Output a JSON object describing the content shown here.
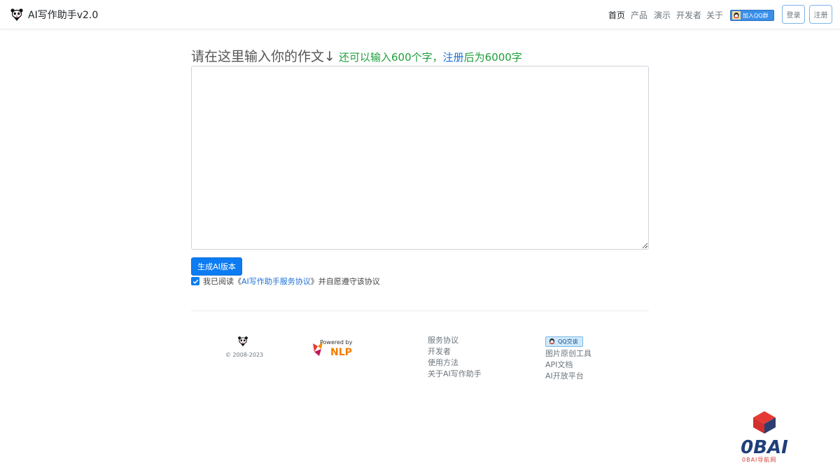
{
  "navbar": {
    "brand": "AI写作助手v2.0",
    "links": [
      "首页",
      "产品",
      "演示",
      "开发者",
      "关于"
    ],
    "active": "首页",
    "qq_group": "加入QQ群",
    "login": "登录",
    "register": "注册"
  },
  "main": {
    "heading": "请在这里输入你的作文↓",
    "hint_prefix": "还可以输入600个字，",
    "hint_register": "注册",
    "hint_suffix": "后为6000字",
    "editor_value": "",
    "generate_button": "生成AI版本",
    "agree_checked": true,
    "agree_prefix": "我已阅读《",
    "agree_link": "AI写作助手服务协议",
    "agree_suffix": "》并自愿遵守该协议"
  },
  "footer": {
    "copyright": "© 2008-2023",
    "powered_by": "Powered by",
    "powered_brand": "NLP",
    "links_col1": [
      "服务协议",
      "开发者",
      "使用方法",
      "关于AI写作助手"
    ],
    "qq_talk": "QQ交谈",
    "links_col2": [
      "图片原创工具",
      "API文档",
      "AI开放平台"
    ]
  },
  "watermark": {
    "logo_text": "0BAI",
    "sub_text": "0BAI导航网"
  },
  "colors": {
    "primary": "#0d7cf2",
    "hint_green": "#1e9e3a",
    "link_blue": "#1e70d6",
    "watermark_red": "#d6413a",
    "watermark_blue": "#1f3f7a"
  }
}
